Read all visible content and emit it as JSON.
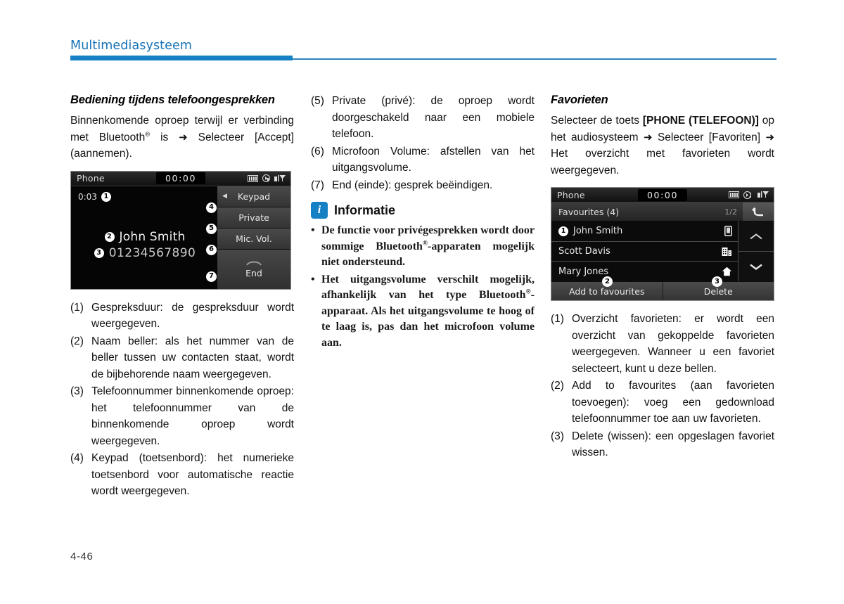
{
  "header": {
    "chapter_title": "Multimediasysteem",
    "accent_color": "#1581c4"
  },
  "footer": {
    "page_number": "4-46"
  },
  "left_column": {
    "heading": "Bediening tijdens telefoongesprekken",
    "intro_part1": "Binnenkomende oproep terwijl er verbinding met Bluetooth",
    "intro_reg": "®",
    "intro_part2": " is ",
    "intro_arrow": "➜",
    "intro_part3": " Selecteer [Accept] (aannemen).",
    "list": [
      {
        "marker": "(1)",
        "text": "Gespreksduur: de gespreksduur wordt weergegeven."
      },
      {
        "marker": "(2)",
        "text": "Naam beller: als het nummer van de beller tussen uw contacten staat, wordt de bijbehorende naam weergegeven."
      },
      {
        "marker": "(3)",
        "text": "Telefoonnummer binnenkomende oproep: het telefoonnummer van de binnenkomende oproep wordt weergegeven."
      },
      {
        "marker": "(4)",
        "text": "Keypad (toetsenbord): het numerieke toetsenbord voor automatische reactie wordt weergegeven."
      }
    ]
  },
  "mid_column": {
    "list": [
      {
        "marker": "(5)",
        "text": "Private (privé): de oproep wordt doorgeschakeld naar een mobiele telefoon."
      },
      {
        "marker": "(6)",
        "text": "Microfoon Volume: afstellen van het uitgangsvolume."
      },
      {
        "marker": "(7)",
        "text": "End (einde): gesprek beëindigen."
      }
    ],
    "info": {
      "badge": "i",
      "title": "Informatie",
      "bullets": [
        {
          "bullet": "•",
          "part1": "De functie voor privégesprekken wordt door sommige Bluetooth",
          "reg": "®",
          "part2": "-apparaten mogelijk niet ondersteund."
        },
        {
          "bullet": "•",
          "part1": "Het uitgangsvolume verschilt mogelijk, afhankelijk van het type Bluetooth",
          "reg": "®",
          "part2": "-apparaat. Als het uitgangsvolume te hoog of te laag is, pas dan het microfoon volume aan."
        }
      ]
    }
  },
  "right_column": {
    "heading": "Favorieten",
    "intro_part1": "Selecteer de toets ",
    "intro_bold": "[PHONE (TELEFOON)]",
    "intro_part2": " op het audiosysteem ",
    "arrow1": "➜",
    "intro_part3": " Selecteer [Favoriten] ",
    "arrow2": "➜",
    "intro_part4": " Het overzicht met favorieten wordt weergegeven.",
    "list": [
      {
        "marker": "(1)",
        "text": "Overzicht favorieten: er wordt een overzicht van gekoppelde favorieten weergegeven. Wanneer u een favoriet selecteert, kunt u deze bellen."
      },
      {
        "marker": "(2)",
        "text": "Add to favourites (aan favorieten toevoegen): voeg een gedownload telefoonnummer toe aan uw favorieten."
      },
      {
        "marker": "(3)",
        "text": "Delete (wissen): een opgeslagen favoriet wissen."
      }
    ]
  },
  "call_screen": {
    "status": {
      "label": "Phone",
      "clock": "00:00",
      "icons": [
        "sd-card-icon",
        "bluetooth-phone-icon",
        "signal-bars-icon"
      ]
    },
    "duration": "0:03",
    "duration_callout": "1",
    "caller_name": "John Smith",
    "caller_name_callout": "2",
    "caller_number": "01234567890",
    "caller_number_callout": "3",
    "buttons": [
      {
        "label": "Keypad",
        "callout": "4",
        "has_caret": true
      },
      {
        "label": "Private",
        "callout": "5",
        "has_caret": false
      },
      {
        "label": "Mic. Vol.",
        "callout": "6",
        "has_caret": false
      },
      {
        "label": "End",
        "callout": "7",
        "has_caret": false,
        "icon": "end-call-icon"
      }
    ]
  },
  "fav_screen": {
    "status": {
      "label": "Phone",
      "clock": "00:00",
      "icons": [
        "sd-card-icon",
        "bluetooth-audio-icon",
        "signal-bars-icon"
      ]
    },
    "list_title": "Favourites (4)",
    "page_indicator": "1/2",
    "back_icon": "back-arrow-icon",
    "rows": [
      {
        "name": "John Smith",
        "callout": "1",
        "type_icon": "mobile-phone-icon"
      },
      {
        "name": "Scott Davis",
        "callout": "",
        "type_icon": "office-building-icon"
      },
      {
        "name": "Mary Jones",
        "callout": "",
        "type_icon": "home-icon"
      }
    ],
    "scroll_up_icon": "chevron-up-icon",
    "scroll_down_icon": "chevron-down-icon",
    "footer_buttons": [
      {
        "label": "Add to favourites",
        "callout": "2"
      },
      {
        "label": "Delete",
        "callout": "3"
      }
    ]
  }
}
